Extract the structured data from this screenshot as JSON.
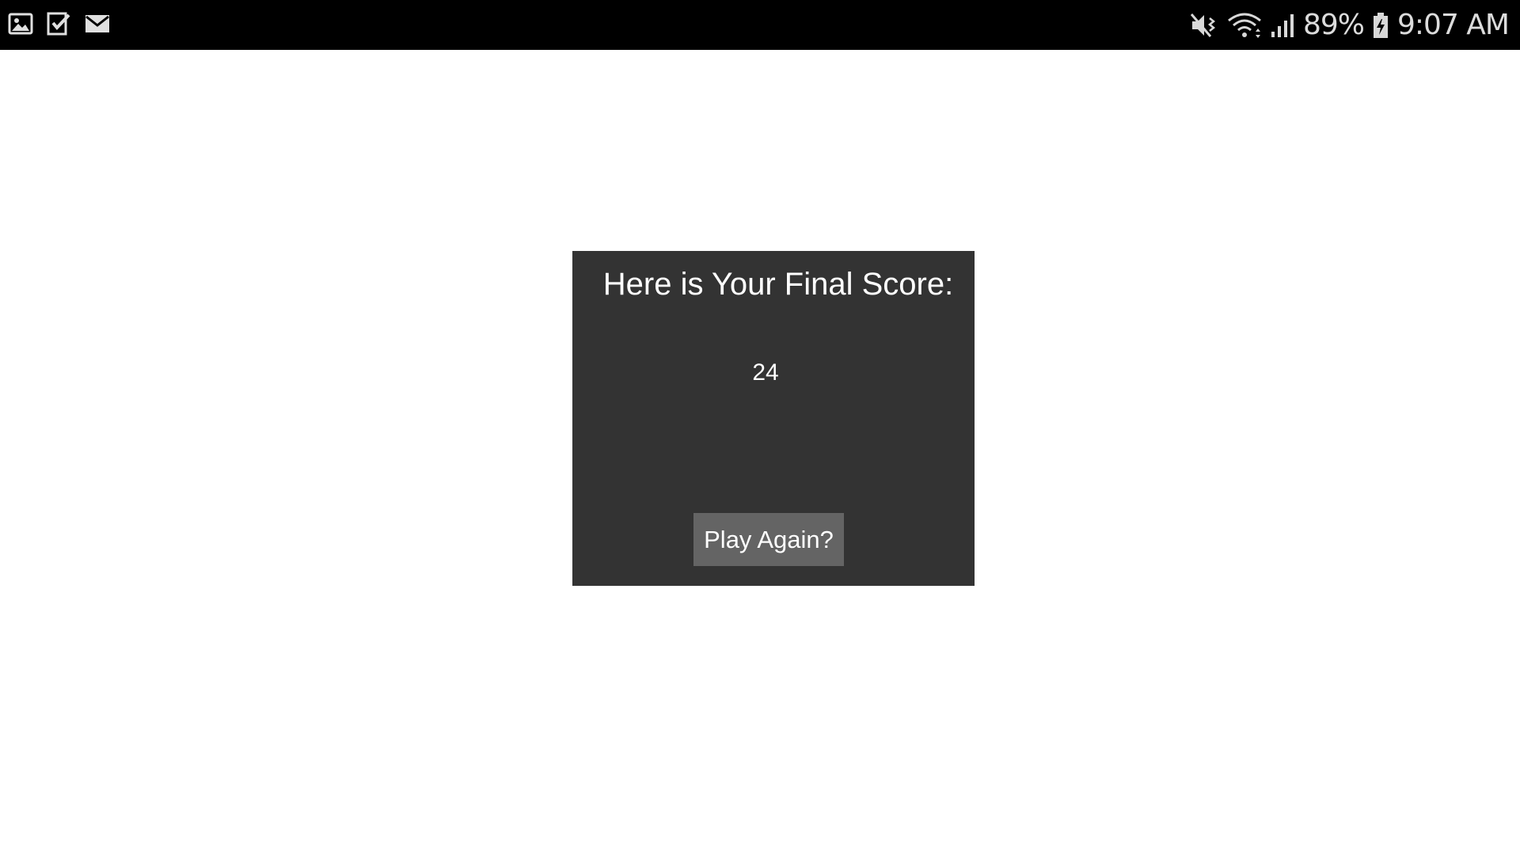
{
  "status_bar": {
    "left_icons": [
      "gallery-icon",
      "task-check-icon",
      "mail-icon"
    ],
    "right_icons": [
      "vibrate-mute-icon",
      "wifi-icon",
      "signal-icon",
      "battery-charging-icon"
    ],
    "battery": "89%",
    "time": "9:07 AM"
  },
  "dialog": {
    "title": "Here is Your Final Score:",
    "score": "24",
    "play_again_label": "Play Again?"
  },
  "colors": {
    "status_bar_bg": "#000000",
    "page_bg": "#ffffff",
    "panel_bg": "#333333",
    "button_bg": "#646464",
    "text": "#ffffff"
  }
}
